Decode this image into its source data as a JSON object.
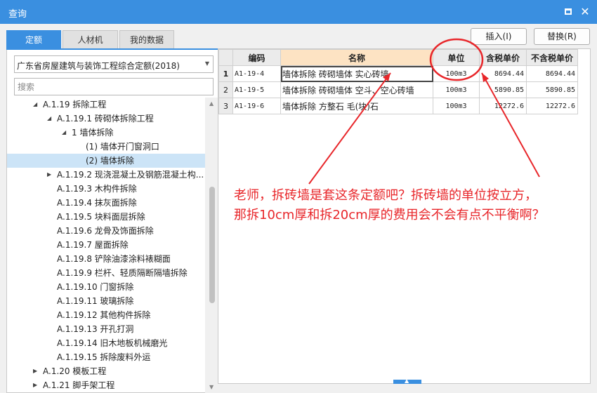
{
  "window": {
    "title": "查询"
  },
  "tabs": [
    {
      "label": "定额"
    },
    {
      "label": "人材机"
    },
    {
      "label": "我的数据"
    }
  ],
  "toolbar": {
    "insert_label": "插入(I)",
    "replace_label": "替换(R)"
  },
  "library": {
    "selected": "广东省房屋建筑与装饰工程综合定额(2018)"
  },
  "search": {
    "placeholder": "搜索",
    "value": ""
  },
  "tree": {
    "items": [
      {
        "label": "A.1.19 拆除工程",
        "expanded": true
      },
      {
        "label": "A.1.19.1 砖砌体拆除工程",
        "expanded": true
      },
      {
        "label": "1 墙体拆除",
        "expanded": true
      },
      {
        "label": "(1) 墙体开门窗洞口"
      },
      {
        "label": "(2) 墙体拆除",
        "selected": true
      },
      {
        "label": "A.1.19.2 现浇混凝土及钢筋混凝土构...",
        "expanded": false
      },
      {
        "label": "A.1.19.3 木构件拆除"
      },
      {
        "label": "A.1.19.4 抹灰面拆除"
      },
      {
        "label": "A.1.19.5 块料面层拆除"
      },
      {
        "label": "A.1.19.6 龙骨及饰面拆除"
      },
      {
        "label": "A.1.19.7 屋面拆除"
      },
      {
        "label": "A.1.19.8 铲除油漆涂料裱糊面"
      },
      {
        "label": "A.1.19.9 栏杆、轻质隔断隔墙拆除"
      },
      {
        "label": "A.1.19.10 门窗拆除"
      },
      {
        "label": "A.1.19.11 玻璃拆除"
      },
      {
        "label": "A.1.19.12 其他构件拆除"
      },
      {
        "label": "A.1.19.13 开孔打洞"
      },
      {
        "label": "A.1.19.14 旧木地板机械磨光"
      },
      {
        "label": "A.1.19.15 拆除废料外运"
      },
      {
        "label": "A.1.20 模板工程",
        "expanded": false
      },
      {
        "label": "A.1.21 脚手架工程",
        "expanded": false
      }
    ]
  },
  "grid": {
    "headers": {
      "code": "编码",
      "name": "名称",
      "unit": "单位",
      "price_tax": "含税单价",
      "price_notax": "不含税单价"
    },
    "rows": [
      {
        "n": "1",
        "code": "A1-19-4",
        "name": "墙体拆除 砖砌墙体 实心砖墙",
        "unit": "100m3",
        "price_tax": "8694.44",
        "price_notax": "8694.44"
      },
      {
        "n": "2",
        "code": "A1-19-5",
        "name": "墙体拆除 砖砌墙体 空斗、空心砖墙",
        "unit": "100m3",
        "price_tax": "5890.85",
        "price_notax": "5890.85"
      },
      {
        "n": "3",
        "code": "A1-19-6",
        "name": "墙体拆除 方整石 毛(块)石",
        "unit": "100m3",
        "price_tax": "12272.6",
        "price_notax": "12272.6"
      }
    ]
  },
  "annotation": {
    "line1": "老师，拆砖墙是套这条定额吧？拆砖墙的单位按立方，",
    "line2": "那拆10cm厚和拆20cm厚的费用会不会有点不平衡啊？",
    "color": "#e8262a"
  },
  "colors": {
    "accent": "#3a8fe0",
    "header_highlight": "#fde3c3",
    "selected_row": "#cce4f7"
  }
}
